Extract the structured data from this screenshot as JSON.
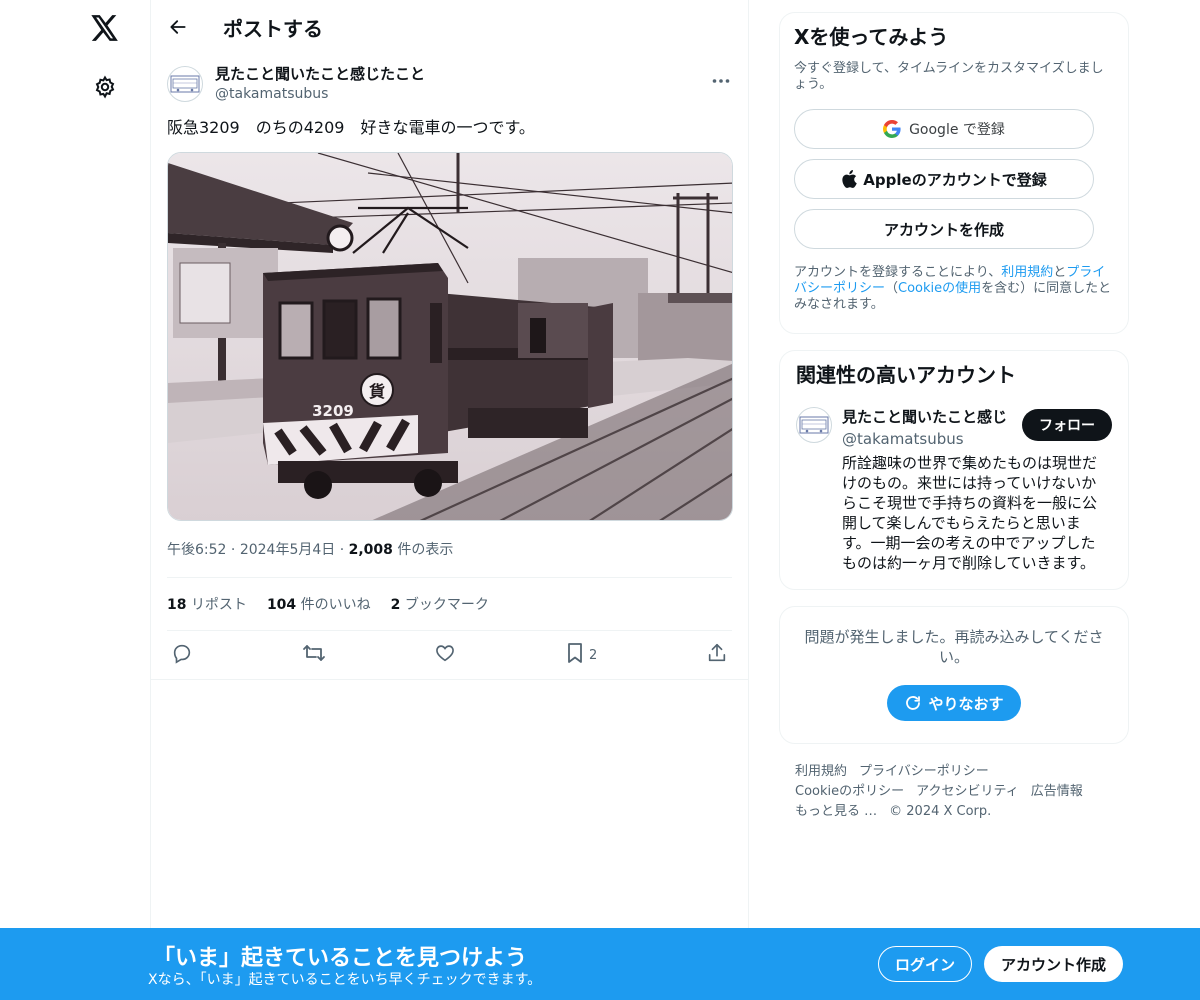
{
  "colors": {
    "accent": "#1d9bf0",
    "text": "#0f1419",
    "muted": "#536471"
  },
  "nav": {
    "logo_icon": "x-logo-icon",
    "settings_icon": "gear-icon"
  },
  "header": {
    "title": "ポストする"
  },
  "post": {
    "author_name": "見たこと聞いたこと感じたこと",
    "author_handle": "@takamatsubus",
    "text": "阪急3209　のちの4209　好きな電車の一つです。",
    "time": "午後6:52",
    "date": "2024年5月4日",
    "views_count": "2,008",
    "views_label": "件の表示",
    "reposts_count": "18",
    "reposts_label": "リポスト",
    "likes_count": "104",
    "likes_label": "件のいいね",
    "bookmarks_count": "2",
    "bookmarks_label": "ブックマーク",
    "bookmark_action_count": "2",
    "media_train_number": "3209",
    "media_badge": "貨"
  },
  "signup_card": {
    "title": "Xを使ってみよう",
    "subtitle": "今すぐ登録して、タイムラインをカスタマイズしましょう。",
    "google_label": "Google で登録",
    "apple_label": "Appleのアカウントで登録",
    "create_label": "アカウントを作成",
    "legal_pre": "アカウントを登録することにより、",
    "legal_terms": "利用規約",
    "legal_and": "と",
    "legal_privacy": "プライバシーポリシー",
    "legal_mid": "（",
    "legal_cookie": "Cookieの使用",
    "legal_post": "を含む）に同意したとみなされます。"
  },
  "related_card": {
    "title": "関連性の高いアカウント",
    "name": "見たこと聞いたこと感じ",
    "handle": "@takamatsubus",
    "follow_label": "フォロー",
    "bio": "所詮趣味の世界で集めたものは現世だけのもの。来世には持っていけないからこそ現世で手持ちの資料を一般に公開して楽しんでもらえたらと思います。一期一会の考えの中でアップしたものは約一ヶ月で削除していきます。"
  },
  "error_card": {
    "message": "問題が発生しました。再読み込みしてください。",
    "retry_label": "やりなおす"
  },
  "footer": {
    "terms": "利用規約",
    "privacy": "プライバシーポリシー",
    "cookie": "Cookieのポリシー",
    "accessibility": "アクセシビリティ",
    "ads": "広告情報",
    "more": "もっと見る …",
    "copyright": "© 2024 X Corp."
  },
  "banner": {
    "title": "「いま」起きていることを見つけよう",
    "subtitle": "Xなら、「いま」起きていることをいち早くチェックできます。",
    "login_label": "ログイン",
    "signup_label": "アカウント作成"
  }
}
